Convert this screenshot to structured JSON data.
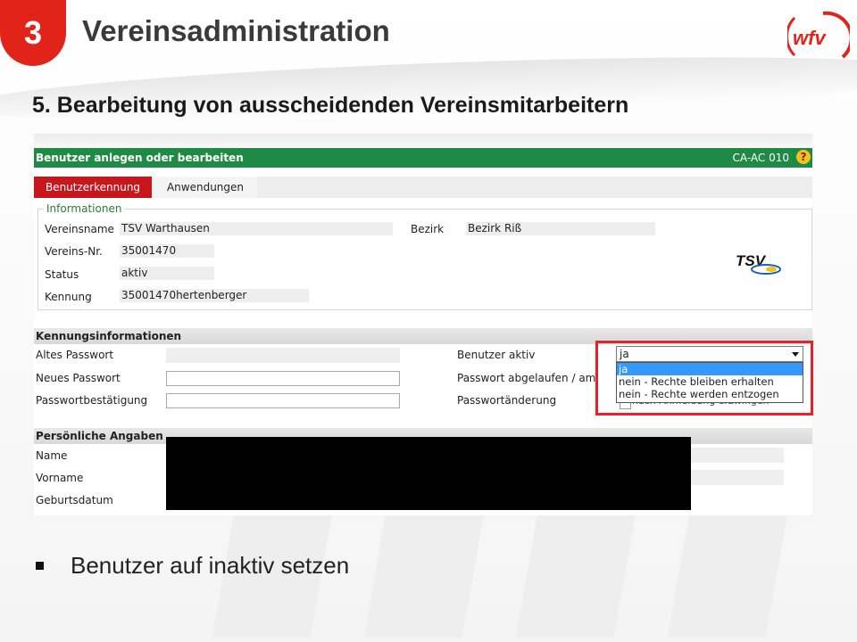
{
  "header": {
    "badge_number": "3",
    "title": "Vereinsadministration",
    "logo_text": "wfv"
  },
  "subtitle": "5. Bearbeitung von ausscheidenden Vereinsmitarbeitern",
  "app": {
    "window_title": "Benutzer anlegen oder bearbeiten",
    "screen_code": "CA-AC 010",
    "help_symbol": "?",
    "tabs": [
      {
        "label": "Benutzerkennung",
        "active": true
      },
      {
        "label": "Anwendungen",
        "active": false
      }
    ],
    "informationen": {
      "legend": "Informationen",
      "vereinsname_label": "Vereinsname",
      "vereinsname_value": "TSV Warthausen",
      "bezirk_label": "Bezirk",
      "bezirk_value": "Bezirk Riß",
      "vereinsnr_label": "Vereins-Nr.",
      "vereinsnr_value": "35001470",
      "status_label": "Status",
      "status_value": "aktiv",
      "kennung_label": "Kennung",
      "kennung_value": "35001470hertenberger",
      "club_logo_text": "TSV"
    },
    "kennungsinformationen": {
      "heading": "Kennungsinformationen",
      "altes_passwort_label": "Altes Passwort",
      "neues_passwort_label": "Neues Passwort",
      "passwortbestaetigung_label": "Passwortbestätigung",
      "benutzer_aktiv_label": "Benutzer aktiv",
      "passwort_abgelaufen_label": "Passwort abgelaufen / am",
      "passwortaenderung_label": "Passwortänderung",
      "benutzer_aktiv_selected": "ja",
      "benutzer_aktiv_options": [
        "ja",
        "nein - Rechte bleiben erhalten",
        "nein - Rechte werden entzogen"
      ],
      "passwortaenderung_checkbox_text": "nach Anmeldung erzwingen"
    },
    "persoenliche_angaben": {
      "heading": "Persönliche Angaben",
      "name_label": "Name",
      "vorname_label": "Vorname",
      "geburtsdatum_label": "Geburtsdatum"
    }
  },
  "bullet_text": "Benutzer auf inaktiv setzen",
  "colors": {
    "brand_red": "#e2231a",
    "header_green": "#1e8a46",
    "active_tab_red": "#c8161d",
    "highlight_red": "#e8202a",
    "selected_option_blue": "#3399ff"
  }
}
